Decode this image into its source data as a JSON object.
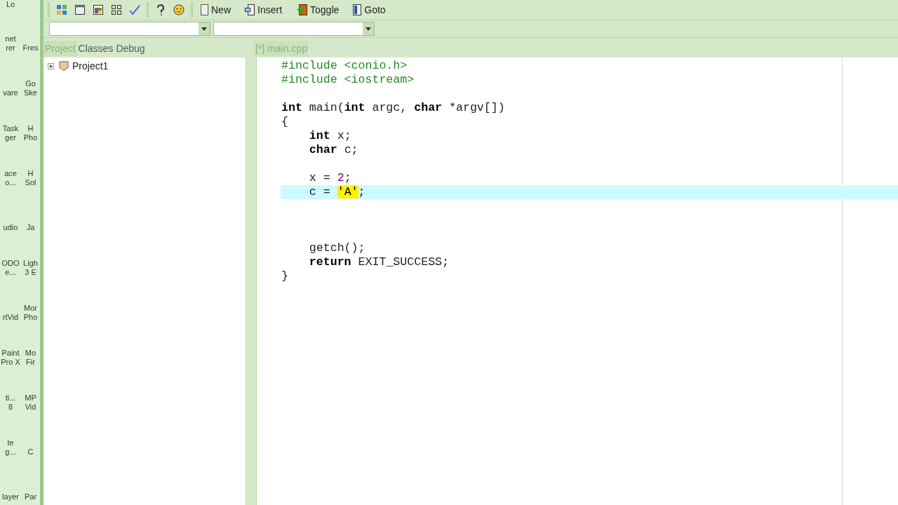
{
  "desktop": {
    "icon_columns": [
      {
        "top_label": "Lo",
        "labels": [
          "net\nrer",
          "vare",
          "Task\nger",
          "ace\no...",
          "udio",
          "ODO\ne...",
          "rtVid",
          "Paint\nPro X",
          "ti...\n8",
          "te\ng...",
          "layer"
        ]
      },
      {
        "labels": [
          "Fres",
          "Go\nSke",
          "H\nPho",
          "H\nSol",
          "Ja",
          "Ligh\n3 E",
          "Mor\nPho",
          "Mo\nFir",
          "MP\nVid",
          "C",
          "Par"
        ]
      }
    ]
  },
  "toolbar": {
    "icon_buttons": [
      {
        "kind": "tiles"
      },
      {
        "kind": "window"
      },
      {
        "kind": "colors"
      },
      {
        "kind": "grid"
      },
      {
        "kind": "check"
      },
      {
        "kind": "help"
      },
      {
        "kind": "smiley"
      }
    ],
    "buttons": [
      {
        "label": "New",
        "kind": "new"
      },
      {
        "label": "Insert",
        "kind": "insert"
      },
      {
        "label": "Toggle",
        "kind": "toggle"
      },
      {
        "label": "Goto",
        "kind": "goto"
      }
    ]
  },
  "side_tabs": [
    {
      "label": "Project",
      "selected": true
    },
    {
      "label": "Classes",
      "selected": false
    },
    {
      "label": "Debug",
      "selected": false
    }
  ],
  "project_tree": [
    {
      "label": "Project1",
      "expanded": false
    }
  ],
  "editor_tabs": [
    {
      "label": "[*] main.cpp",
      "selected": true
    }
  ],
  "editor": {
    "lines": [
      {
        "current": false,
        "tokens": [
          {
            "kind": "pre",
            "text": "#include <conio.h>"
          }
        ]
      },
      {
        "current": false,
        "tokens": [
          {
            "kind": "pre",
            "text": "#include <iostream>"
          }
        ]
      },
      {
        "current": false
      },
      {
        "current": false,
        "tokens": [
          {
            "kind": "keyword",
            "text": "int"
          },
          {
            "kind": "plain",
            "text": " main("
          },
          {
            "kind": "keyword",
            "text": "int"
          },
          {
            "kind": "plain",
            "text": " argc, "
          },
          {
            "kind": "keyword",
            "text": "char"
          },
          {
            "kind": "plain",
            "text": " *argv[])"
          }
        ]
      },
      {
        "current": false,
        "tokens": [
          {
            "kind": "plain",
            "text": "{"
          }
        ]
      },
      {
        "current": false,
        "tokens": [
          {
            "kind": "keyword",
            "text": "    int"
          },
          {
            "kind": "plain",
            "text": " x;"
          }
        ]
      },
      {
        "current": false,
        "tokens": [
          {
            "kind": "keyword",
            "text": "    char"
          },
          {
            "kind": "plain",
            "text": " c;"
          }
        ]
      },
      {
        "current": false
      },
      {
        "current": false,
        "tokens": [
          {
            "kind": "plain",
            "text": "    x = "
          },
          {
            "kind": "number",
            "text": "2"
          },
          {
            "kind": "plain",
            "text": ";"
          }
        ]
      },
      {
        "current": true,
        "tokens": [
          {
            "kind": "plain",
            "text": "    c = "
          },
          {
            "kind": "char",
            "text": "'A'"
          },
          {
            "kind": "plain",
            "text": ";"
          }
        ]
      },
      {
        "current": false
      },
      {
        "current": false
      },
      {
        "current": false
      },
      {
        "current": false,
        "tokens": [
          {
            "kind": "plain",
            "text": "    getch();"
          }
        ]
      },
      {
        "current": false,
        "tokens": [
          {
            "kind": "keyword",
            "text": "    return"
          },
          {
            "kind": "plain",
            "text": " EXIT_SUCCESS;"
          }
        ]
      },
      {
        "current": false,
        "tokens": [
          {
            "kind": "plain",
            "text": "}"
          }
        ]
      }
    ]
  }
}
